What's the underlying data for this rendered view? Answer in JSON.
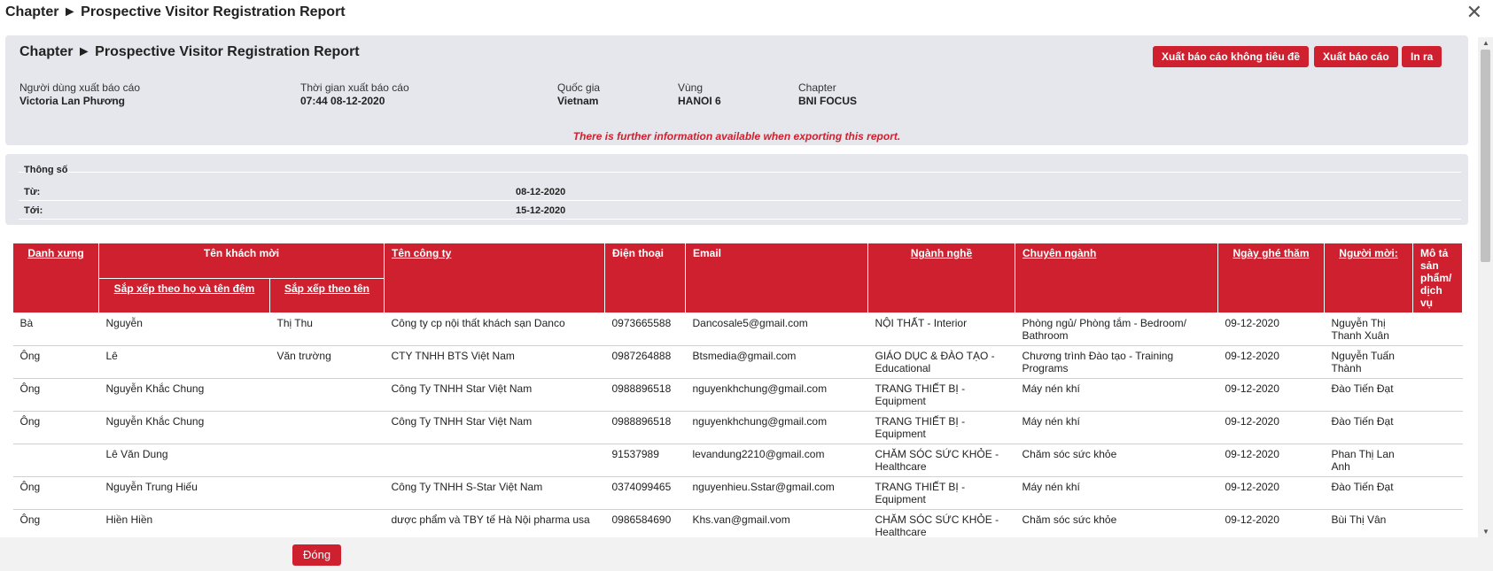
{
  "window": {
    "title": "Chapter ► Prospective Visitor Registration Report"
  },
  "report": {
    "title": "Chapter ► Prospective Visitor Registration Report",
    "buttons": {
      "export_no_title": "Xuất báo cáo không tiêu đề",
      "export": "Xuất báo cáo",
      "print": "In ra"
    },
    "meta": {
      "user_label": "Người dùng xuất báo cáo",
      "user_value": "Victoria Lan Phương",
      "time_label": "Thời gian xuất báo cáo",
      "time_value": "07:44 08-12-2020",
      "country_label": "Quốc gia",
      "country_value": "Vietnam",
      "region_label": "Vùng",
      "region_value": "HANOI 6",
      "chapter_label": "Chapter",
      "chapter_value": "BNI FOCUS"
    },
    "notice": "There is further information available when exporting this report."
  },
  "params": {
    "heading": "Thông số",
    "from_label": "Từ:",
    "from_value": "08-12-2020",
    "to_label": "Tới:",
    "to_value": "15-12-2020"
  },
  "table": {
    "headers": {
      "salutation": "Danh xưng",
      "guest_name": "Tên khách mời",
      "sort_surname": "Sắp xếp theo họ và tên đệm",
      "sort_name": "Sắp xếp theo tên",
      "company": "Tên công ty",
      "phone": "Điện thoại",
      "email": "Email",
      "industry": "Ngành nghề",
      "specialty": "Chuyên ngành",
      "visit_date": "Ngày ghé thăm",
      "inviter": "Người mời:",
      "description": "Mô tả sản phẩm/ dịch vụ"
    },
    "rows": [
      {
        "salutation": "Bà",
        "surname": "Nguyễn",
        "name": "Thị Thu",
        "company": "Công ty cp nội thất khách sạn Danco",
        "phone": "0973665588",
        "email": "Dancosale5@gmail.com",
        "industry": "NỘI THẤT - Interior",
        "specialty": "Phòng ngủ/ Phòng tắm - Bedroom/ Bathroom",
        "visit_date": "09-12-2020",
        "inviter": "Nguyễn Thị Thanh Xuân",
        "description": ""
      },
      {
        "salutation": "Ông",
        "surname": "Lê",
        "name": "Văn trường",
        "company": "CTY TNHH BTS Việt Nam",
        "phone": "0987264888",
        "email": "Btsmedia@gmail.com",
        "industry": "GIÁO DỤC & ĐÀO TẠO - Educational",
        "specialty": "Chương trình Đào tạo - Training Programs",
        "visit_date": "09-12-2020",
        "inviter": "Nguyễn Tuấn Thành",
        "description": ""
      },
      {
        "salutation": "Ông",
        "surname": "Nguyễn Khắc Chung",
        "name": "",
        "company": "Công Ty TNHH Star Việt Nam",
        "phone": "0988896518",
        "email": "nguyenkhchung@gmail.com",
        "industry": "TRANG THIẾT BỊ - Equipment",
        "specialty": "Máy nén khí",
        "visit_date": "09-12-2020",
        "inviter": "Đào Tiến Đạt",
        "description": ""
      },
      {
        "salutation": "Ông",
        "surname": "Nguyễn Khắc Chung",
        "name": "",
        "company": "Công Ty TNHH Star Việt Nam",
        "phone": "0988896518",
        "email": "nguyenkhchung@gmail.com",
        "industry": "TRANG THIẾT BỊ - Equipment",
        "specialty": "Máy nén khí",
        "visit_date": "09-12-2020",
        "inviter": "Đào Tiến Đạt",
        "description": ""
      },
      {
        "salutation": "",
        "surname": "Lê Văn Dung",
        "name": "",
        "company": "",
        "phone": "91537989",
        "email": "levandung2210@gmail.com",
        "industry": "CHĂM SÓC SỨC KHỎE - Healthcare",
        "specialty": "Chăm sóc sức khỏe",
        "visit_date": "09-12-2020",
        "inviter": "Phan Thị Lan Anh",
        "description": ""
      },
      {
        "salutation": "Ông",
        "surname": "Nguyễn Trung Hiếu",
        "name": "",
        "company": "Công Ty TNHH S-Star Việt Nam",
        "phone": "0374099465",
        "email": "nguyenhieu.Sstar@gmail.com",
        "industry": "TRANG THIẾT BỊ - Equipment",
        "specialty": "Máy nén khí",
        "visit_date": "09-12-2020",
        "inviter": "Đào Tiến Đạt",
        "description": ""
      },
      {
        "salutation": "Ông",
        "surname": "Hiền Hiền",
        "name": "",
        "company": "dược phẩm và TBY tế Hà Nội pharma usa",
        "phone": "0986584690",
        "email": "Khs.van@gmail.vom",
        "industry": "CHĂM SÓC SỨC KHỎE - Healthcare",
        "specialty": "Chăm sóc sức khỏe",
        "visit_date": "09-12-2020",
        "inviter": "Bùi Thị Vân",
        "description": ""
      }
    ]
  },
  "footer": {
    "close_label": "Đóng"
  },
  "colors": {
    "accent": "#cf2030",
    "panel": "#e5e7ec"
  }
}
